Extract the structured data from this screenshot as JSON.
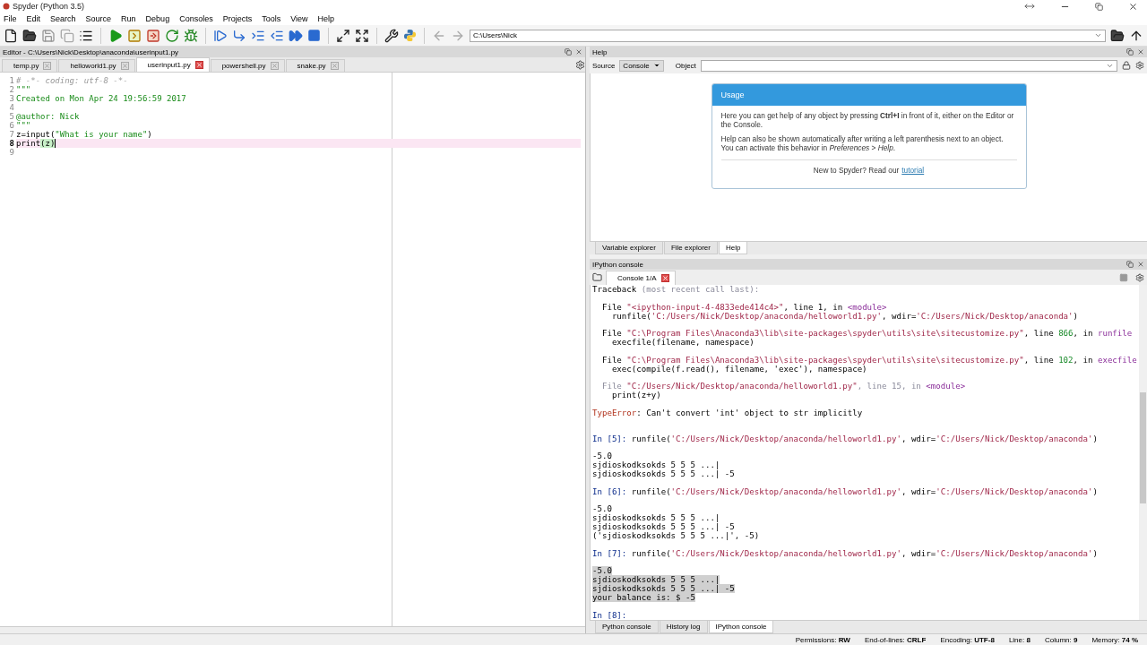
{
  "window": {
    "title": "Spyder (Python 3.5)"
  },
  "menu": [
    "File",
    "Edit",
    "Search",
    "Source",
    "Run",
    "Debug",
    "Consoles",
    "Projects",
    "Tools",
    "View",
    "Help"
  ],
  "toolbar": {
    "path": "C:\\Users\\Nick"
  },
  "editor": {
    "title": "Editor - C:\\Users\\Nick\\Desktop\\anaconda\\userinput1.py",
    "tabs": [
      {
        "label": "temp.py",
        "selected": false
      },
      {
        "label": "helloworld1.py",
        "selected": false
      },
      {
        "label": "userinput1.py",
        "selected": true
      },
      {
        "label": "powershell.py",
        "selected": false
      },
      {
        "label": "snake.py",
        "selected": false
      }
    ],
    "lines": [
      {
        "number": "1",
        "current": false,
        "tokens": [
          {
            "kind": "comment",
            "text": "# -*- coding: utf-8 -*-"
          }
        ]
      },
      {
        "number": "2",
        "current": false,
        "tokens": [
          {
            "kind": "string",
            "text": "\"\"\""
          }
        ]
      },
      {
        "number": "3",
        "current": false,
        "tokens": [
          {
            "kind": "string",
            "text": "Created on Mon Apr 24 19:56:59 2017"
          }
        ]
      },
      {
        "number": "4",
        "current": false
      },
      {
        "number": "5",
        "current": false,
        "tokens": [
          {
            "kind": "string",
            "text": "@author: Nick"
          }
        ]
      },
      {
        "number": "6",
        "current": false,
        "tokens": [
          {
            "kind": "string",
            "text": "\"\"\""
          }
        ]
      },
      {
        "number": "7",
        "current": false,
        "tokens": [
          {
            "kind": "plain",
            "text": "z=input("
          },
          {
            "kind": "string",
            "text": "\"What is your name\""
          },
          {
            "kind": "plain",
            "text": ")"
          }
        ]
      },
      {
        "number": "8",
        "current": true,
        "tokens": [
          {
            "kind": "plain",
            "text": "print"
          },
          {
            "kind": "match",
            "text": "(z)"
          }
        ]
      },
      {
        "number": "9",
        "current": false
      }
    ]
  },
  "help": {
    "title": "Help",
    "source_label": "Source",
    "source_value": "Console",
    "object_label": "Object",
    "card": {
      "title": "Usage",
      "paragraphs": [
        "Here you can get help of any object by pressing **Ctrl+I** in front of it, either on the Editor or the Console.",
        "Help can also be shown automatically after writing a left parenthesis next to an object. You can activate this behavior in *Preferences* > *Help*."
      ],
      "footer": "New to Spyder? Read our",
      "link": "tutorial"
    },
    "tabs": [
      {
        "label": "Variable explorer",
        "selected": false
      },
      {
        "label": "File explorer",
        "selected": false
      },
      {
        "label": "Help",
        "selected": true
      }
    ]
  },
  "console": {
    "title": "IPython console",
    "tab": "Console 1/A",
    "lines": [
      {
        "kind": "text",
        "selected": false,
        "tokens": [
          {
            "kind": "plain",
            "text": "Traceback "
          },
          {
            "kind": "faded",
            "text": "(most recent call last):"
          }
        ]
      },
      {
        "kind": "blank"
      },
      {
        "kind": "text",
        "selected": false,
        "tokens": [
          {
            "kind": "plain",
            "text": "  File "
          },
          {
            "kind": "string",
            "text": "\"<ipython-input-4-4833ede414c4>\""
          },
          {
            "kind": "plain",
            "text": ", line 1, in "
          },
          {
            "kind": "func",
            "text": "<module>"
          }
        ]
      },
      {
        "kind": "text",
        "selected": false,
        "tokens": [
          {
            "kind": "plain",
            "text": "    runfile("
          },
          {
            "kind": "string",
            "text": "'C:/Users/Nick/Desktop/anaconda/helloworld1.py'"
          },
          {
            "kind": "plain",
            "text": ", wdir="
          },
          {
            "kind": "string",
            "text": "'C:/Users/Nick/Desktop/anaconda'"
          },
          {
            "kind": "plain",
            "text": ")"
          }
        ]
      },
      {
        "kind": "blank"
      },
      {
        "kind": "text",
        "selected": false,
        "tokens": [
          {
            "kind": "plain",
            "text": "  File "
          },
          {
            "kind": "string",
            "text": "\"C:\\Program Files\\Anaconda3\\lib\\site-packages\\spyder\\utils\\site\\sitecustomize.py\""
          },
          {
            "kind": "plain",
            "text": ", line "
          },
          {
            "kind": "number",
            "text": "866"
          },
          {
            "kind": "plain",
            "text": ", in "
          },
          {
            "kind": "func",
            "text": "runfile"
          }
        ]
      },
      {
        "kind": "text",
        "selected": false,
        "tokens": [
          {
            "kind": "plain",
            "text": "    execfile(filename, namespace)"
          }
        ]
      },
      {
        "kind": "blank"
      },
      {
        "kind": "text",
        "selected": false,
        "tokens": [
          {
            "kind": "plain",
            "text": "  File "
          },
          {
            "kind": "string",
            "text": "\"C:\\Program Files\\Anaconda3\\lib\\site-packages\\spyder\\utils\\site\\sitecustomize.py\""
          },
          {
            "kind": "plain",
            "text": ", line "
          },
          {
            "kind": "number",
            "text": "102"
          },
          {
            "kind": "plain",
            "text": ", in "
          },
          {
            "kind": "func",
            "text": "execfile"
          }
        ]
      },
      {
        "kind": "text",
        "selected": false,
        "tokens": [
          {
            "kind": "plain",
            "text": "    exec(compile(f.read(), filename, 'exec'), namespace)"
          }
        ]
      },
      {
        "kind": "blank"
      },
      {
        "kind": "text",
        "selected": false,
        "tokens": [
          {
            "kind": "faded",
            "text": "  File "
          },
          {
            "kind": "string",
            "text": "\"C:/Users/Nick/Desktop/anaconda/helloworld1.py\""
          },
          {
            "kind": "faded",
            "text": ", line 15, in "
          },
          {
            "kind": "func",
            "text": "<module>"
          }
        ]
      },
      {
        "kind": "text",
        "selected": false,
        "tokens": [
          {
            "kind": "plain",
            "text": "    print(z+y)"
          }
        ]
      },
      {
        "kind": "blank"
      },
      {
        "kind": "text",
        "selected": false,
        "tokens": [
          {
            "kind": "error",
            "text": "TypeError"
          },
          {
            "kind": "plain",
            "text": ": Can't convert 'int' object to str implicitly"
          }
        ]
      },
      {
        "kind": "blank"
      },
      {
        "kind": "blank"
      },
      {
        "kind": "text",
        "selected": false,
        "tokens": [
          {
            "kind": "prompt",
            "text": "In [5]:"
          },
          {
            "kind": "plain",
            "text": " runfile("
          },
          {
            "kind": "string",
            "text": "'C:/Users/Nick/Desktop/anaconda/helloworld1.py'"
          },
          {
            "kind": "plain",
            "text": ", wdir="
          },
          {
            "kind": "string",
            "text": "'C:/Users/Nick/Desktop/anaconda'"
          },
          {
            "kind": "plain",
            "text": ")"
          }
        ]
      },
      {
        "kind": "blank"
      },
      {
        "kind": "text",
        "selected": false,
        "tokens": [
          {
            "kind": "plain",
            "text": "-5.0"
          }
        ]
      },
      {
        "kind": "text",
        "selected": false,
        "tokens": [
          {
            "kind": "plain",
            "text": "sjdioskodksokds 5 5 5 ...|"
          }
        ]
      },
      {
        "kind": "text",
        "selected": false,
        "tokens": [
          {
            "kind": "plain",
            "text": "sjdioskodksokds 5 5 5 ...| -5"
          }
        ]
      },
      {
        "kind": "blank"
      },
      {
        "kind": "text",
        "selected": false,
        "tokens": [
          {
            "kind": "prompt",
            "text": "In [6]:"
          },
          {
            "kind": "plain",
            "text": " runfile("
          },
          {
            "kind": "string",
            "text": "'C:/Users/Nick/Desktop/anaconda/helloworld1.py'"
          },
          {
            "kind": "plain",
            "text": ", wdir="
          },
          {
            "kind": "string",
            "text": "'C:/Users/Nick/Desktop/anaconda'"
          },
          {
            "kind": "plain",
            "text": ")"
          }
        ]
      },
      {
        "kind": "blank"
      },
      {
        "kind": "text",
        "selected": false,
        "tokens": [
          {
            "kind": "plain",
            "text": "-5.0"
          }
        ]
      },
      {
        "kind": "text",
        "selected": false,
        "tokens": [
          {
            "kind": "plain",
            "text": "sjdioskodksokds 5 5 5 ...|"
          }
        ]
      },
      {
        "kind": "text",
        "selected": false,
        "tokens": [
          {
            "kind": "plain",
            "text": "sjdioskodksokds 5 5 5 ...| -5"
          }
        ]
      },
      {
        "kind": "text",
        "selected": false,
        "tokens": [
          {
            "kind": "plain",
            "text": "('sjdioskodksokds 5 5 5 ...|', -5)"
          }
        ]
      },
      {
        "kind": "blank"
      },
      {
        "kind": "text",
        "selected": false,
        "tokens": [
          {
            "kind": "prompt",
            "text": "In [7]:"
          },
          {
            "kind": "plain",
            "text": " runfile("
          },
          {
            "kind": "string",
            "text": "'C:/Users/Nick/Desktop/anaconda/helloworld1.py'"
          },
          {
            "kind": "plain",
            "text": ", wdir="
          },
          {
            "kind": "string",
            "text": "'C:/Users/Nick/Desktop/anaconda'"
          },
          {
            "kind": "plain",
            "text": ")"
          }
        ]
      },
      {
        "kind": "blank"
      },
      {
        "kind": "text",
        "selected": true,
        "tokens": [
          {
            "kind": "plain",
            "text": "-5.0"
          }
        ]
      },
      {
        "kind": "text",
        "selected": true,
        "tokens": [
          {
            "kind": "plain",
            "text": "sjdioskodksokds 5 5 5 ...|"
          }
        ]
      },
      {
        "kind": "text",
        "selected": true,
        "tokens": [
          {
            "kind": "plain",
            "text": "sjdioskodksokds 5 5 5 ...| -5"
          }
        ]
      },
      {
        "kind": "text",
        "selected": true,
        "tokens": [
          {
            "kind": "plain",
            "text": "your balance is: $ -5"
          }
        ]
      },
      {
        "kind": "blank"
      },
      {
        "kind": "text",
        "selected": false,
        "tokens": [
          {
            "kind": "prompt",
            "text": "In [8]:"
          }
        ]
      }
    ],
    "tabs": [
      {
        "label": "Python console",
        "selected": false
      },
      {
        "label": "History log",
        "selected": false
      },
      {
        "label": "IPython console",
        "selected": true
      }
    ]
  },
  "status_bar": [
    {
      "label": "Permissions:",
      "value": "RW"
    },
    {
      "label": "End-of-lines:",
      "value": "CRLF"
    },
    {
      "label": "Encoding:",
      "value": "UTF-8"
    },
    {
      "label": "Line:",
      "value": "8"
    },
    {
      "label": "Column:",
      "value": "9"
    },
    {
      "label": "Memory:",
      "value": "74 %"
    }
  ]
}
